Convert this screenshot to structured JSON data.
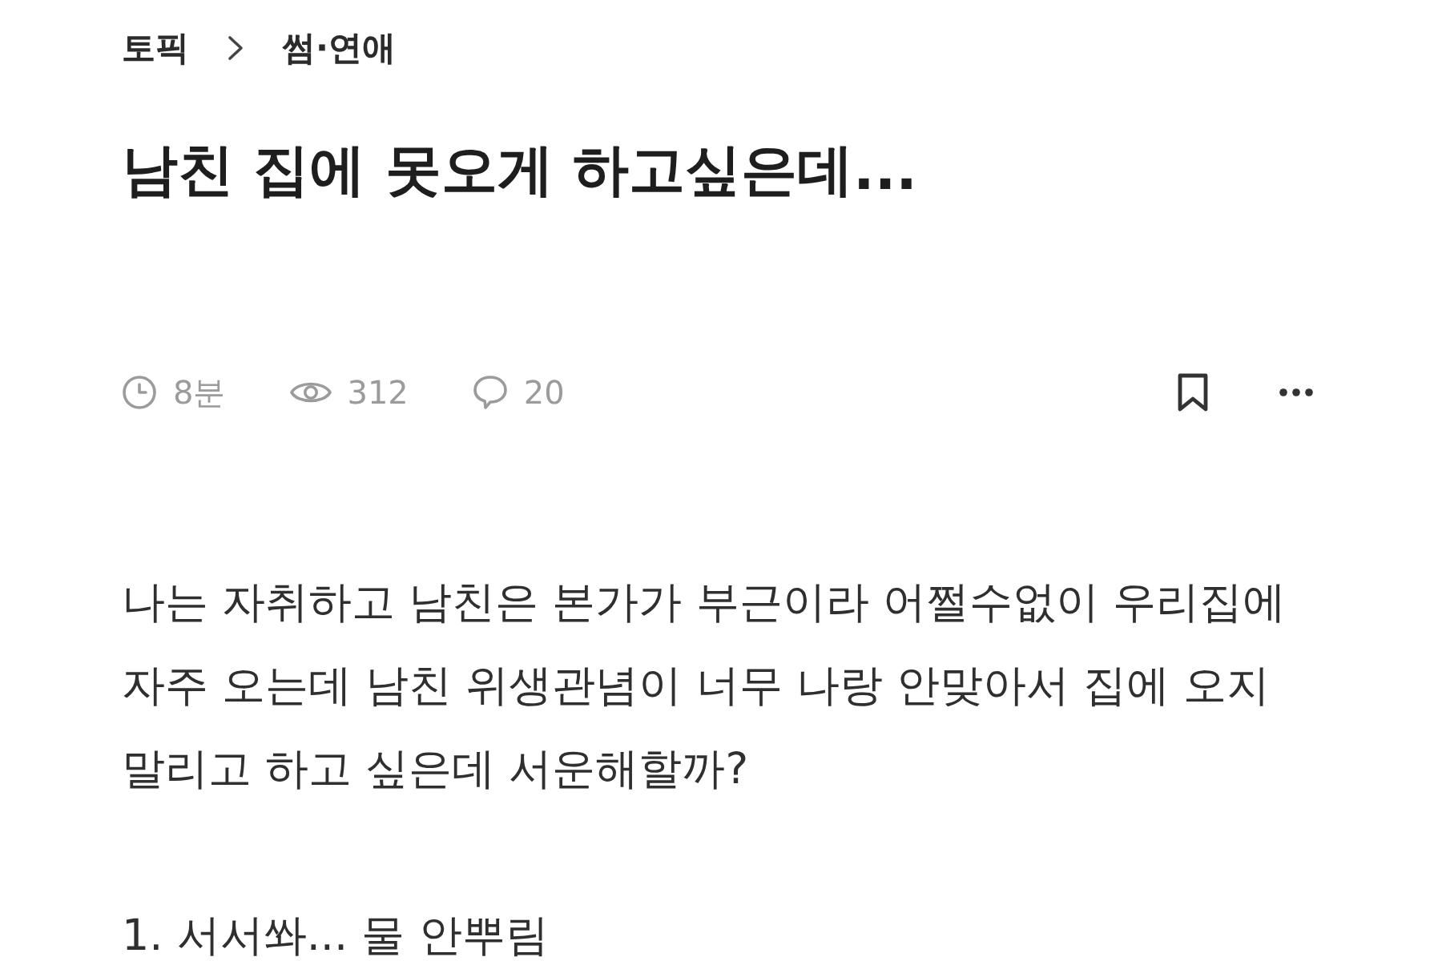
{
  "breadcrumb": {
    "items": [
      {
        "label": "토픽"
      },
      {
        "label": "썸·연애"
      }
    ]
  },
  "post": {
    "title": "남친 집에 못오게 하고싶은데...",
    "meta": [
      {
        "kind": "time",
        "text": "8분"
      },
      {
        "kind": "views",
        "text": "312"
      },
      {
        "kind": "comments",
        "text": "20"
      }
    ],
    "actions": [
      {
        "kind": "bookmark"
      },
      {
        "kind": "more"
      }
    ]
  },
  "body": {
    "paragraphs": [
      {
        "lines": [
          "나는 자취하고 남친은 본가가 부근이라 어쩔수없이 우리집에",
          "자주 오는데 남친 위생관념이 너무 나랑 안맞아서 집에 오지",
          "말리고 하고 싶은데 서운해할까?"
        ]
      },
      {
        "lines": [
          "1. 서서쏴... 물 안뿌림"
        ]
      }
    ]
  }
}
